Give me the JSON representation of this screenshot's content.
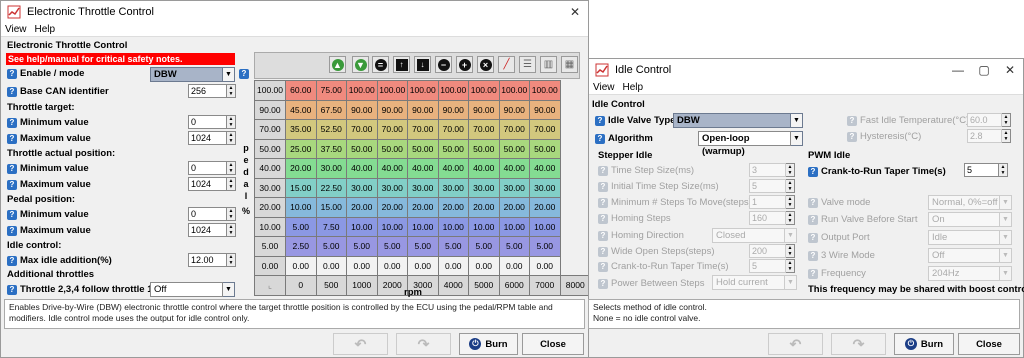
{
  "etc": {
    "title": "Electronic Throttle Control",
    "menu": [
      "View",
      "Help"
    ],
    "section_title": "Electronic Throttle Control",
    "warning": "See help/manual for critical safety notes.",
    "enable_label": "Enable / mode",
    "enable_value": "DBW",
    "can_label": "Base CAN identifier",
    "can_value": "256",
    "throttle_target": "Throttle target:",
    "tt_min_label": "Minimum value",
    "tt_min": "0",
    "tt_max_label": "Maximum value",
    "tt_max": "1024",
    "throttle_actual": "Throttle actual position:",
    "ta_min_label": "Minimum value",
    "ta_min": "0",
    "ta_max_label": "Maximum value",
    "ta_max": "1024",
    "pedal_position": "Pedal position:",
    "pp_min_label": "Minimum value",
    "pp_min": "0",
    "pp_max_label": "Maximum value",
    "pp_max": "1024",
    "idle_control": "Idle control:",
    "idle_add_label": "Max idle addition(%)",
    "idle_add": "12.00",
    "additional": "Additional throttles",
    "follow_label": "Throttle 2,3,4 follow throttle 1",
    "follow_value": "Off",
    "pedal_axis": [
      "p",
      "e",
      "d",
      "a",
      "l"
    ],
    "pct": "%",
    "rpm_axis": "rpm",
    "table": {
      "rows": [
        {
          "label": "100.00",
          "values": [
            "60.00",
            "75.00",
            "100.00",
            "100.00",
            "100.00",
            "100.00",
            "100.00",
            "100.00",
            "100.00"
          ]
        },
        {
          "label": "90.00",
          "values": [
            "45.00",
            "67.50",
            "90.00",
            "90.00",
            "90.00",
            "90.00",
            "90.00",
            "90.00",
            "90.00"
          ]
        },
        {
          "label": "70.00",
          "values": [
            "35.00",
            "52.50",
            "70.00",
            "70.00",
            "70.00",
            "70.00",
            "70.00",
            "70.00",
            "70.00"
          ]
        },
        {
          "label": "50.00",
          "values": [
            "25.00",
            "37.50",
            "50.00",
            "50.00",
            "50.00",
            "50.00",
            "50.00",
            "50.00",
            "50.00"
          ]
        },
        {
          "label": "40.00",
          "values": [
            "20.00",
            "30.00",
            "40.00",
            "40.00",
            "40.00",
            "40.00",
            "40.00",
            "40.00",
            "40.00"
          ]
        },
        {
          "label": "30.00",
          "values": [
            "15.00",
            "22.50",
            "30.00",
            "30.00",
            "30.00",
            "30.00",
            "30.00",
            "30.00",
            "30.00"
          ]
        },
        {
          "label": "20.00",
          "values": [
            "10.00",
            "15.00",
            "20.00",
            "20.00",
            "20.00",
            "20.00",
            "20.00",
            "20.00",
            "20.00"
          ]
        },
        {
          "label": "10.00",
          "values": [
            "5.00",
            "7.50",
            "10.00",
            "10.00",
            "10.00",
            "10.00",
            "10.00",
            "10.00",
            "10.00"
          ]
        },
        {
          "label": "5.00",
          "values": [
            "2.50",
            "5.00",
            "5.00",
            "5.00",
            "5.00",
            "5.00",
            "5.00",
            "5.00",
            "5.00"
          ]
        },
        {
          "label": "0.00",
          "values": [
            "0.00",
            "0.00",
            "0.00",
            "0.00",
            "0.00",
            "0.00",
            "0.00",
            "0.00",
            "0.00"
          ]
        }
      ],
      "columns": [
        "0",
        "500",
        "1000",
        "2000",
        "3000",
        "4000",
        "5000",
        "6000",
        "7000",
        "8000"
      ],
      "row_colors": [
        "#f08a7e",
        "#e8b27e",
        "#d2c87e",
        "#a8d87e",
        "#84dc92",
        "#82cfc7",
        "#86b9dc",
        "#8b98e4",
        "#9897e2",
        "#f2f2f2"
      ]
    },
    "description": "Enables Drive-by-Wire (DBW) electronic throttle control where the target throttle position is controlled by the ECU using the pedal/RPM table and modifiers. Idle control mode uses the output for idle control only.",
    "burn": "Burn",
    "close": "Close"
  },
  "idle": {
    "title": "Idle Control",
    "menu": [
      "View",
      "Help"
    ],
    "section_title": "Idle Control",
    "valve_type_label": "Idle Valve Type",
    "valve_type_value": "DBW",
    "algorithm_label": "Algorithm",
    "algorithm_value": "Open-loop (warmup)",
    "fast_idle_label": "Fast Idle Temperature(°C)",
    "fast_idle_value": "60.0",
    "hysteresis_label": "Hysteresis(°C)",
    "hysteresis_value": "2.8",
    "stepper_title": "Stepper Idle",
    "stepper": [
      {
        "label": "Time Step Size(ms)",
        "value": "3"
      },
      {
        "label": "Initial Time Step Size(ms)",
        "value": "5"
      },
      {
        "label": "Minimum # Steps To Move(steps)",
        "value": "1"
      },
      {
        "label": "Homing Steps",
        "value": "160"
      }
    ],
    "homing_dir_label": "Homing Direction",
    "homing_dir_value": "Closed",
    "wide_open_label": "Wide Open Steps(steps)",
    "wide_open_value": "200",
    "crank_taper_label": "Crank-to-Run Taper Time(s)",
    "crank_taper_value": "5",
    "power_between_label": "Power Between Steps",
    "power_between_value": "Hold current",
    "pwm_title": "PWM Idle",
    "pwm_crank_label": "Crank-to-Run Taper Time(s)",
    "pwm_crank_value": "5",
    "valve_mode_label": "Valve mode",
    "valve_mode_value": "Normal, 0%=off",
    "run_before_label": "Run Valve Before Start",
    "run_before_value": "On",
    "output_port_label": "Output Port",
    "output_port_value": "Idle",
    "three_wire_label": "3 Wire Mode",
    "three_wire_value": "Off",
    "frequency_label": "Frequency",
    "frequency_value": "204Hz",
    "boost_note": "This frequency may be shared with boost control",
    "description": "Selects method of idle control.\nNone = no idle control valve.",
    "burn": "Burn",
    "close": "Close"
  }
}
